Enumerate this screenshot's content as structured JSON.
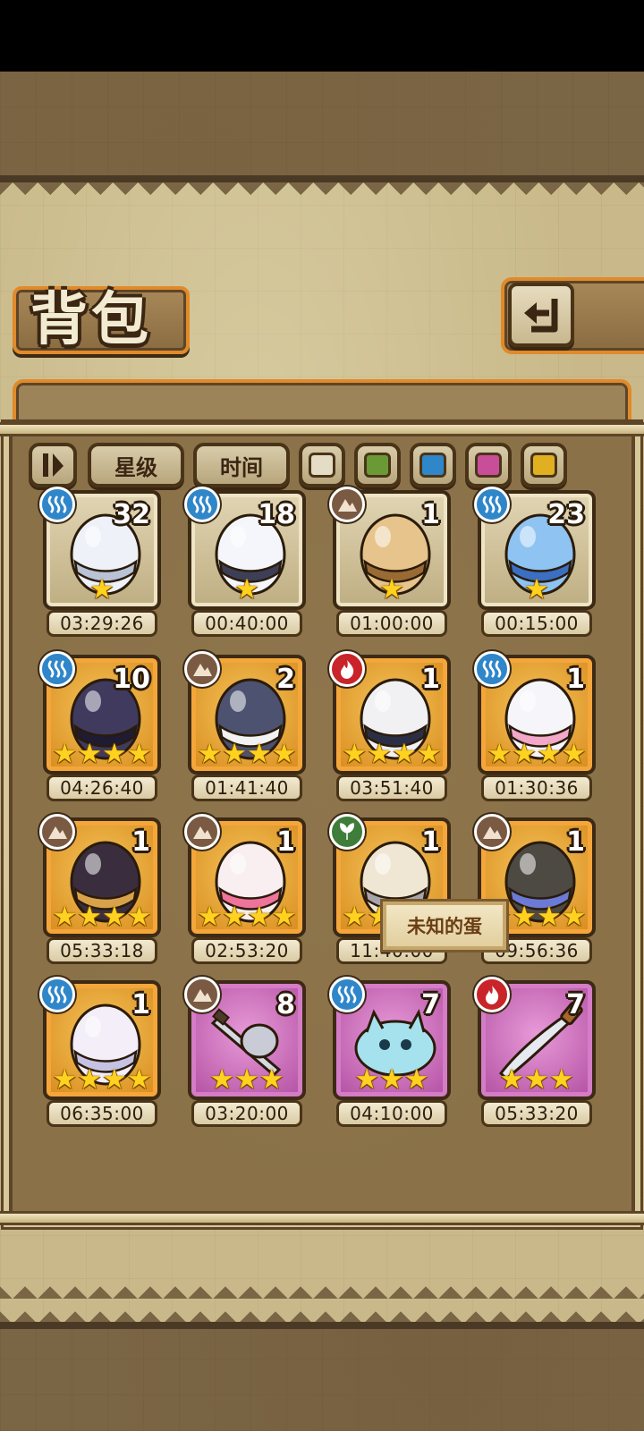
{
  "page": {
    "title": "背包"
  },
  "filters": {
    "sort_order_icon": "sort-toggle-icon",
    "star_label": "星级",
    "time_label": "时间",
    "colors": [
      {
        "name": "white-filter",
        "color": "#e4dcc4"
      },
      {
        "name": "green-filter",
        "color": "#6a9a36"
      },
      {
        "name": "blue-filter",
        "color": "#2f86c9"
      },
      {
        "name": "pink-filter",
        "color": "#c84e9a"
      },
      {
        "name": "yellow-filter",
        "color": "#e0b020"
      }
    ]
  },
  "tooltip": {
    "text": "未知的蛋"
  },
  "eggs": [
    {
      "element": "water",
      "count": "32",
      "stars": 1,
      "timer": "03:29:26",
      "quality": "q1",
      "art": "swirl-white-egg"
    },
    {
      "element": "water",
      "count": "18",
      "stars": 1,
      "timer": "00:40:00",
      "quality": "q1",
      "art": "wrapped-white-egg"
    },
    {
      "element": "earth",
      "count": "1",
      "stars": 1,
      "timer": "01:00:00",
      "quality": "q1",
      "art": "spotted-tan-egg"
    },
    {
      "element": "water",
      "count": "23",
      "stars": 1,
      "timer": "00:15:00",
      "quality": "q1",
      "art": "blue-slime-egg"
    },
    {
      "element": "water",
      "count": "10",
      "stars": 4,
      "timer": "04:26:40",
      "quality": "q4",
      "art": "dark-feather-egg"
    },
    {
      "element": "earth",
      "count": "2",
      "stars": 4,
      "timer": "01:41:40",
      "quality": "q4",
      "art": "navy-fur-egg"
    },
    {
      "element": "fire",
      "count": "1",
      "stars": 4,
      "timer": "03:51:40",
      "quality": "q4",
      "art": "captain-hat-egg"
    },
    {
      "element": "water",
      "count": "1",
      "stars": 4,
      "timer": "01:30:36",
      "quality": "q4",
      "art": "heart-bow-egg"
    },
    {
      "element": "earth",
      "count": "1",
      "stars": 4,
      "timer": "05:33:18",
      "quality": "q4",
      "art": "horned-dark-egg"
    },
    {
      "element": "earth",
      "count": "1",
      "stars": 4,
      "timer": "02:53:20",
      "quality": "q4",
      "art": "pink-heart-egg"
    },
    {
      "element": "wood",
      "count": "1",
      "stars": 4,
      "timer": "11:40:00",
      "quality": "q4",
      "art": "crowned-egg"
    },
    {
      "element": "earth",
      "count": "1",
      "stars": 4,
      "timer": "09:56:36",
      "quality": "q4",
      "art": "rock-crystal-egg"
    },
    {
      "element": "water",
      "count": "1",
      "stars": 4,
      "timer": "06:35:00",
      "quality": "q4",
      "art": "pearl-wing-egg"
    },
    {
      "element": "earth",
      "count": "8",
      "stars": 3,
      "timer": "03:20:00",
      "quality": "q3",
      "art": "sword-armor-item"
    },
    {
      "element": "water",
      "count": "7",
      "stars": 3,
      "timer": "04:10:00",
      "quality": "q3",
      "art": "water-blob-item"
    },
    {
      "element": "fire",
      "count": "7",
      "stars": 3,
      "timer": "05:33:20",
      "quality": "q3",
      "art": "dagger-item"
    }
  ]
}
